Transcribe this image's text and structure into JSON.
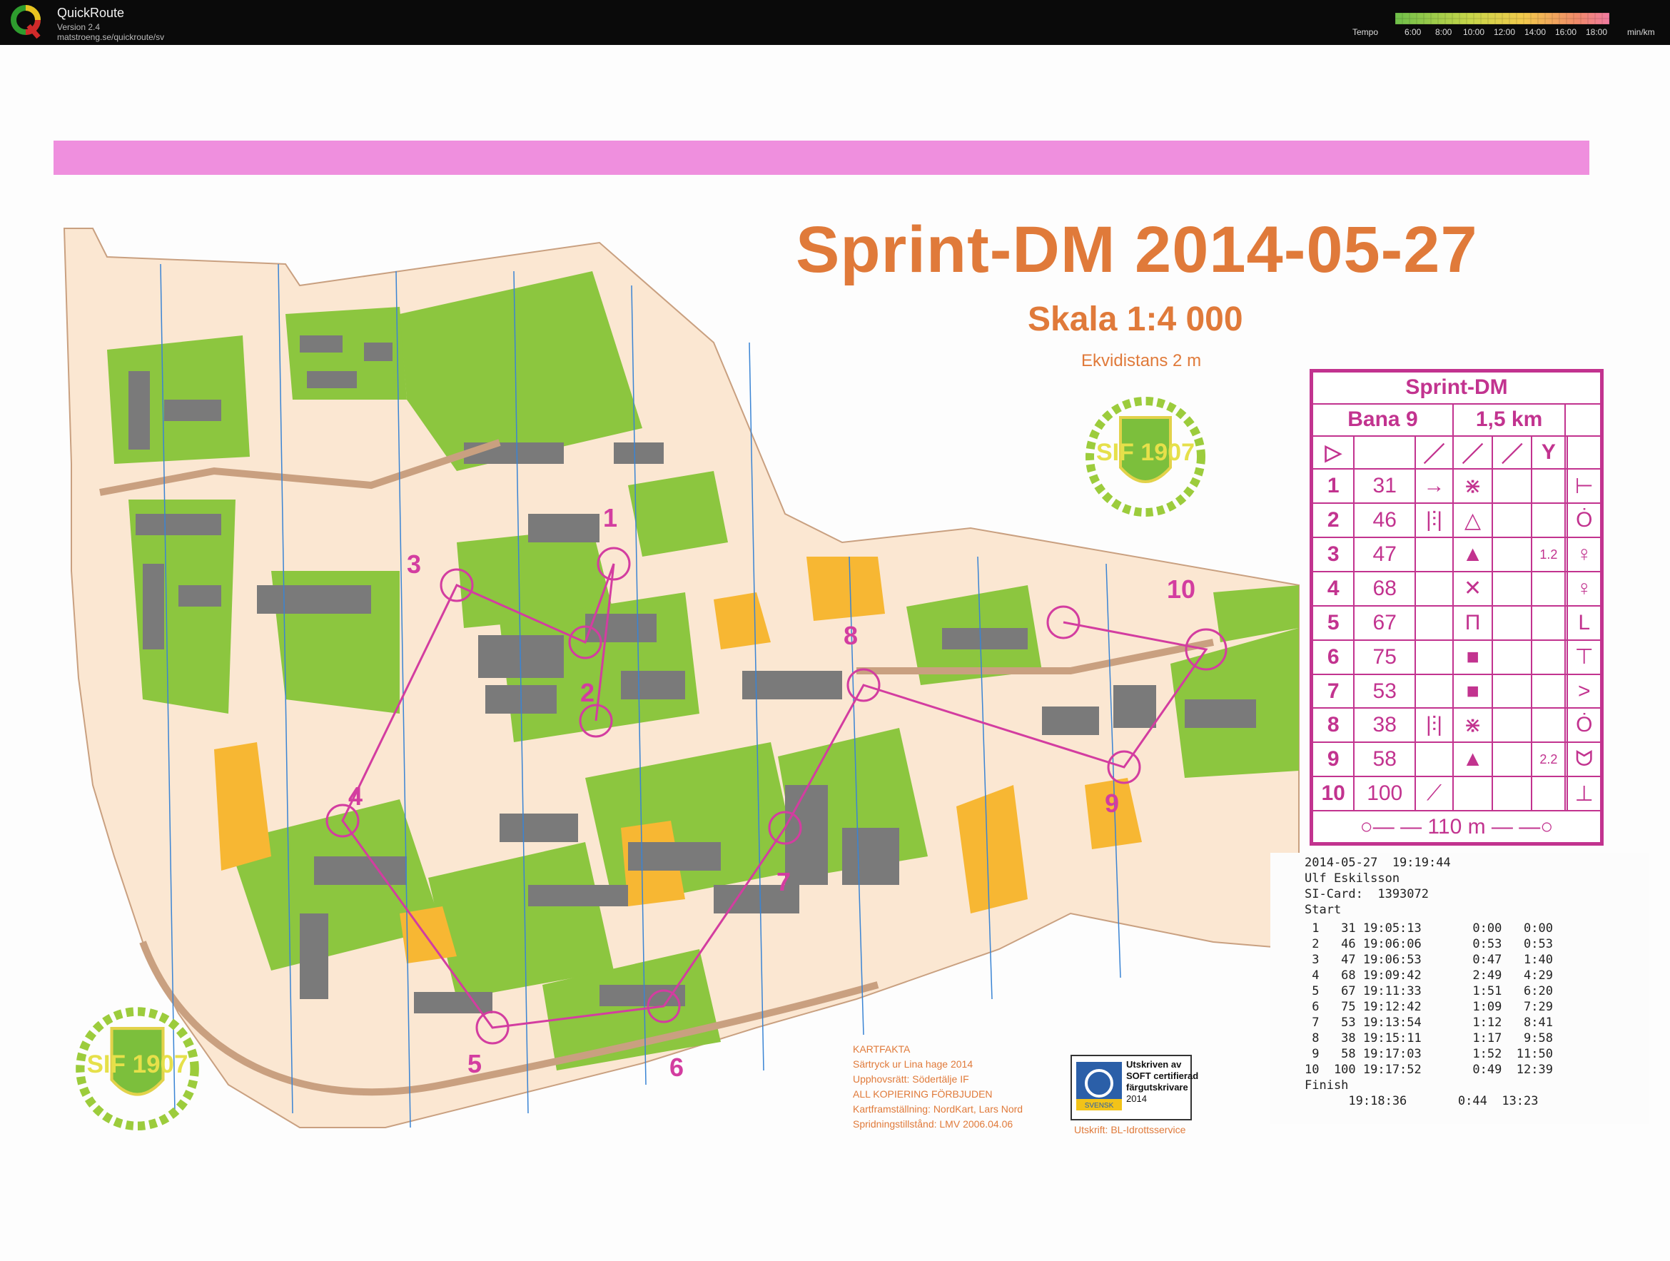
{
  "app": {
    "title": "QuickRoute",
    "version": "Version 2.4",
    "url": "matstroeng.se/quickroute/sv"
  },
  "tempo": {
    "label": "Tempo",
    "ticks": [
      "6:00",
      "8:00",
      "10:00",
      "12:00",
      "14:00",
      "16:00",
      "18:00"
    ],
    "unit": "min/km"
  },
  "map": {
    "title": "Sprint-DM 2014-05-27",
    "scale": "Skala 1:4 000",
    "equidistance": "Ekvidistans 2 m",
    "club_badge": "SIF 1907",
    "control_numbers": [
      "1",
      "2",
      "3",
      "4",
      "5",
      "6",
      "7",
      "8",
      "9",
      "10"
    ]
  },
  "description": {
    "header": "Sprint-DM",
    "course": "Bana 9",
    "length": "1,5 km",
    "rows": [
      {
        "num": "1",
        "code": "31",
        "c3": "→",
        "c4": "⋇",
        "c5": "",
        "c6": "",
        "c8": "⊢"
      },
      {
        "num": "2",
        "code": "46",
        "c3": "|⫶|",
        "c4": "△",
        "c5": "",
        "c6": "",
        "c8": "Ȯ"
      },
      {
        "num": "3",
        "code": "47",
        "c3": "",
        "c4": "▲",
        "c5": "",
        "c6": "1.2",
        "c8": "♀"
      },
      {
        "num": "4",
        "code": "68",
        "c3": "",
        "c4": "✕",
        "c5": "",
        "c6": "",
        "c8": "♀"
      },
      {
        "num": "5",
        "code": "67",
        "c3": "",
        "c4": "Π",
        "c5": "",
        "c6": "",
        "c8": "L"
      },
      {
        "num": "6",
        "code": "75",
        "c3": "",
        "c4": "■",
        "c5": "",
        "c6": "",
        "c8": "⊤"
      },
      {
        "num": "7",
        "code": "53",
        "c3": "",
        "c4": "■",
        "c5": "",
        "c6": "",
        "c8": ">"
      },
      {
        "num": "8",
        "code": "38",
        "c3": "|⫶|",
        "c4": "⋇",
        "c5": "",
        "c6": "",
        "c8": "Ȯ"
      },
      {
        "num": "9",
        "code": "58",
        "c3": "",
        "c4": "▲",
        "c5": "",
        "c6": "2.2",
        "c8": "ᗢ"
      },
      {
        "num": "10",
        "code": "100",
        "c3": "⟋",
        "c4": "",
        "c5": "",
        "c6": "",
        "c8": "⊥"
      }
    ],
    "finish": "110 m"
  },
  "punch": {
    "date": "2014-05-27  19:19:44",
    "name": "Ulf Eskilsson",
    "si": "SI-Card:  1393072",
    "start": "Start",
    "rows": [
      " 1   31 19:05:13       0:00   0:00",
      " 2   46 19:06:06       0:53   0:53",
      " 3   47 19:06:53       0:47   1:40",
      " 4   68 19:09:42       2:49   4:29",
      " 5   67 19:11:33       1:51   6:20",
      " 6   75 19:12:42       1:09   7:29",
      " 7   53 19:13:54       1:12   8:41",
      " 8   38 19:15:11       1:17   9:58",
      " 9   58 19:17:03       1:52  11:50",
      "10  100 19:17:52       0:49  12:39"
    ],
    "finish": "Finish",
    "finish_row": "      19:18:36       0:44  13:23"
  },
  "kartfakta": [
    "KARTFAKTA",
    "Särtryck ur Lina hage 2014",
    "Upphovsrätt: Södertälje IF",
    "ALL KOPIERING FÖRBJUDEN",
    "Kartframställning: NordKart, Lars Nord",
    "Spridningstillstånd: LMV 2006.04.06"
  ],
  "soft": {
    "line1": "Utskriven av",
    "line2": "SOFT certifierad",
    "line3": "färgutskrivare",
    "year": "2014",
    "badge": "SVENSK"
  },
  "utskrift": "Utskrift: BL-Idrottsservice",
  "colors": {
    "magenta": "#c2338f",
    "orange_text": "#e07a3a",
    "green": "#8cc63f",
    "grey": "#7a7a7a",
    "yellow": "#f7b733"
  }
}
